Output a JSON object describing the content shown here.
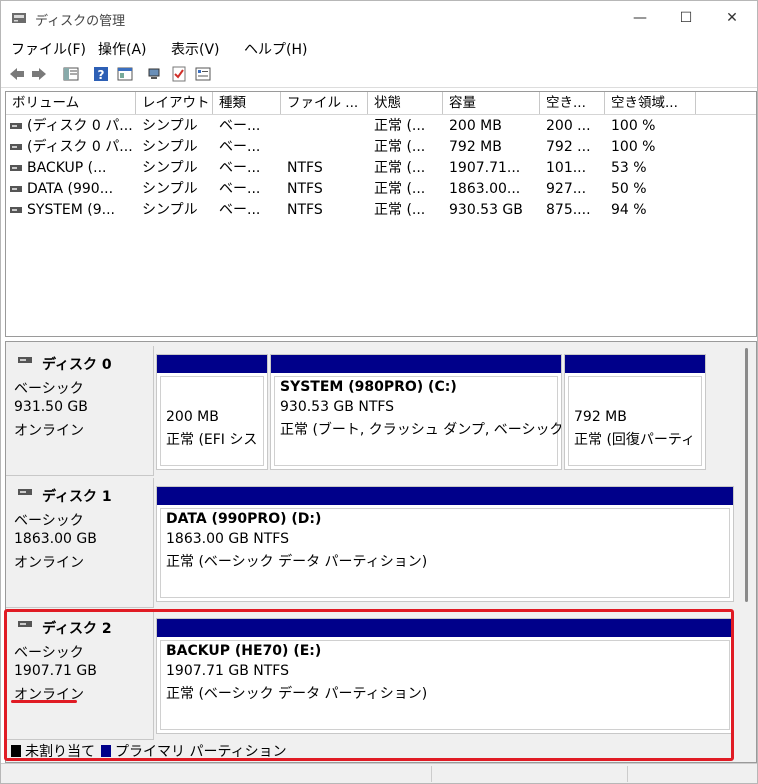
{
  "window": {
    "title": "ディスクの管理",
    "minimize_glyph": "—",
    "maximize_glyph": "☐",
    "close_glyph": "✕"
  },
  "menu": {
    "items": [
      "ファイル(F)",
      "操作(A)",
      "表示(V)",
      "ヘルプ(H)"
    ]
  },
  "toolbar": {
    "icons": [
      "back-icon",
      "forward-icon",
      "console-tree-icon",
      "help-icon",
      "properties-icon",
      "connect-icon",
      "check-icon",
      "list-icon"
    ]
  },
  "volume_list": {
    "columns": [
      "ボリューム",
      "レイアウト",
      "種類",
      "ファイル ...",
      "状態",
      "容量",
      "空き...",
      "空き領域..."
    ],
    "rows": [
      [
        "(ディスク 0 パ...",
        "シンプル",
        "ベー...",
        "",
        "正常 (...",
        "200 MB",
        "200 ...",
        "100 %"
      ],
      [
        "(ディスク 0 パ...",
        "シンプル",
        "ベー...",
        "",
        "正常 (...",
        "792 MB",
        "792 ...",
        "100 %"
      ],
      [
        "BACKUP (...",
        "シンプル",
        "ベー...",
        "NTFS",
        "正常 (...",
        "1907.71...",
        "101...",
        "53 %"
      ],
      [
        "DATA (990...",
        "シンプル",
        "ベー...",
        "NTFS",
        "正常 (...",
        "1863.00...",
        "927...",
        "50 %"
      ],
      [
        "SYSTEM (9...",
        "シンプル",
        "ベー...",
        "NTFS",
        "正常 (...",
        "930.53 GB",
        "875....",
        "94 %"
      ]
    ]
  },
  "disks": [
    {
      "name": "ディスク 0",
      "type": "ベーシック",
      "size": "931.50 GB",
      "status": "オンライン",
      "partitions": [
        {
          "title": "",
          "line1": "200 MB",
          "line2": "正常 (EFI シス"
        },
        {
          "title": "SYSTEM (980PRO) (C:)",
          "line1": "930.53 GB NTFS",
          "line2": "正常 (ブート, クラッシュ ダンプ, ベーシック デ"
        },
        {
          "title": "",
          "line1": "792 MB",
          "line2": "正常 (回復パーティ"
        }
      ]
    },
    {
      "name": "ディスク 1",
      "type": "ベーシック",
      "size": "1863.00 GB",
      "status": "オンライン",
      "partitions": [
        {
          "title": "DATA (990PRO) (D:)",
          "line1": "1863.00 GB NTFS",
          "line2": "正常 (ベーシック データ パーティション)"
        }
      ]
    },
    {
      "name": "ディスク 2",
      "type": "ベーシック",
      "size": "1907.71 GB",
      "status": "オンライン",
      "partitions": [
        {
          "title": "BACKUP (HE70) (E:)",
          "line1": "1907.71 GB NTFS",
          "line2": "正常 (ベーシック データ パーティション)"
        }
      ]
    }
  ],
  "legend": {
    "unallocated": {
      "label": "未割り当て",
      "color": "#000000"
    },
    "primary": {
      "label": "プライマリ パーティション",
      "color": "#00008a"
    }
  },
  "colors": {
    "partition_bar": "#00008a",
    "highlight": "#e01b24"
  }
}
